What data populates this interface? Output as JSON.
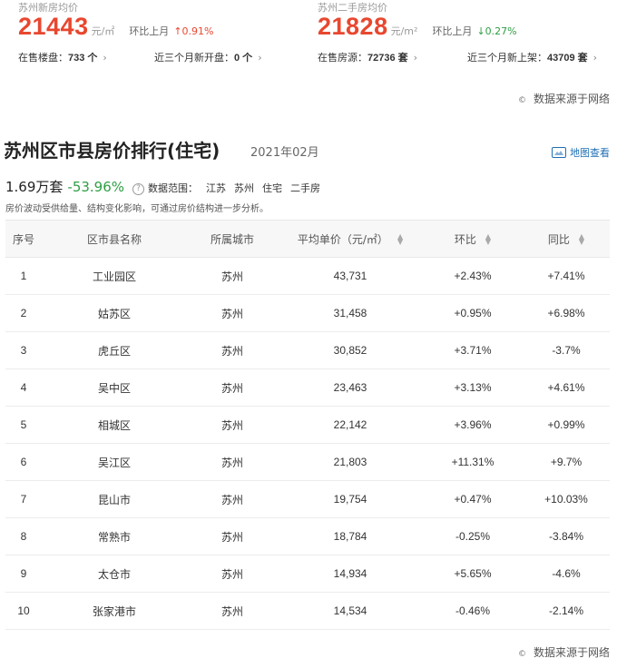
{
  "new_home": {
    "label": "苏州新房均价",
    "price": "21443",
    "unit": "元/㎡",
    "mom_label": "环比上月",
    "mom_value": "↑0.91%",
    "stat1_label": "在售楼盘：",
    "stat1_value": "733 个",
    "stat2_label": "近三个月新开盘：",
    "stat2_value": "0 个"
  },
  "second_home": {
    "label": "苏州二手房均价",
    "price": "21828",
    "unit": "元/m²",
    "mom_label": "环比上月",
    "mom_value": "↓0.27%",
    "stat1_label": "在售房源：",
    "stat1_value": "72736 套",
    "stat2_label": "近三个月新上架：",
    "stat2_value": "43709 套"
  },
  "source_note": "数据来源于网络",
  "ranking": {
    "title": "苏州区市县房价排行(住宅)",
    "date": "2021年02月",
    "map_link": "地图查看",
    "total": "1.69万套",
    "change": "-53.96%",
    "help_icon": "?",
    "scope_label": "数据范围：",
    "scope_tags": [
      "江苏",
      "苏州",
      "住宅",
      "二手房"
    ],
    "note": "房价波动受供给量、结构变化影响，可通过房价结构进一步分析。",
    "columns": [
      "序号",
      "区市县名称",
      "所属城市",
      "平均单价（元/㎡）",
      "环比",
      "同比"
    ],
    "rows": [
      {
        "rank": "1",
        "district": "工业园区",
        "city": "苏州",
        "price": "43,731",
        "mom": "+2.43%",
        "yoy": "+7.41%"
      },
      {
        "rank": "2",
        "district": "姑苏区",
        "city": "苏州",
        "price": "31,458",
        "mom": "+0.95%",
        "yoy": "+6.98%"
      },
      {
        "rank": "3",
        "district": "虎丘区",
        "city": "苏州",
        "price": "30,852",
        "mom": "+3.71%",
        "yoy": "-3.7%"
      },
      {
        "rank": "4",
        "district": "吴中区",
        "city": "苏州",
        "price": "23,463",
        "mom": "+3.13%",
        "yoy": "+4.61%"
      },
      {
        "rank": "5",
        "district": "相城区",
        "city": "苏州",
        "price": "22,142",
        "mom": "+3.96%",
        "yoy": "+0.99%"
      },
      {
        "rank": "6",
        "district": "吴江区",
        "city": "苏州",
        "price": "21,803",
        "mom": "+11.31%",
        "yoy": "+9.7%"
      },
      {
        "rank": "7",
        "district": "昆山市",
        "city": "苏州",
        "price": "19,754",
        "mom": "+0.47%",
        "yoy": "+10.03%"
      },
      {
        "rank": "8",
        "district": "常熟市",
        "city": "苏州",
        "price": "18,784",
        "mom": "-0.25%",
        "yoy": "-3.84%"
      },
      {
        "rank": "9",
        "district": "太仓市",
        "city": "苏州",
        "price": "14,934",
        "mom": "+5.65%",
        "yoy": "-4.6%"
      },
      {
        "rank": "10",
        "district": "张家港市",
        "city": "苏州",
        "price": "14,534",
        "mom": "-0.46%",
        "yoy": "-2.14%"
      }
    ]
  },
  "colors": {
    "price_red": "#e8472f",
    "up_red": "#d9363e",
    "down_green": "#2e9e44",
    "link_blue": "#1f6fb5"
  },
  "icons": [
    "copyright-icon",
    "map-icon",
    "help-icon",
    "chevron-right-icon",
    "sort-icon"
  ]
}
